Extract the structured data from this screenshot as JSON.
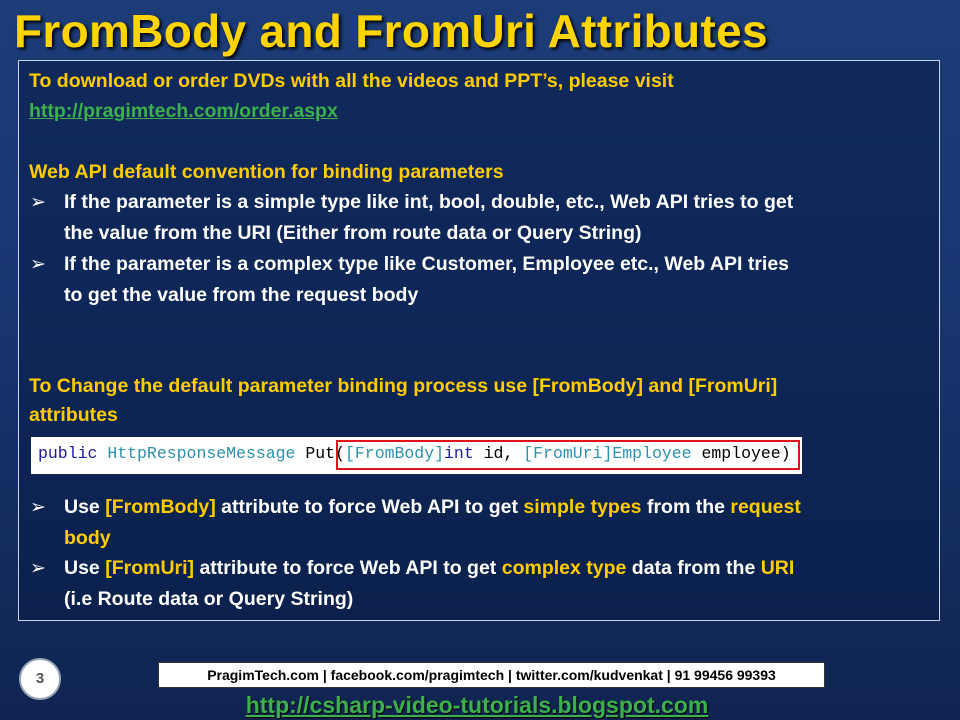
{
  "slide": {
    "title": "FromBody and FromUri Attributes",
    "page_number": "3"
  },
  "content": {
    "download_text": "To download or order DVDs with all the videos and PPT’s, please visit",
    "download_link": "http://pragimtech.com/order.aspx",
    "convention_heading": "Web API default convention for binding parameters",
    "bullets1": [
      {
        "line1": "If the parameter is a simple type like int, bool, double, etc., Web API tries to get",
        "line2": "the value from the URI (Either from route data or Query String)"
      },
      {
        "line1": "If the parameter is a complex type like Customer, Employee etc., Web API tries",
        "line2": "to get the value from the request body"
      }
    ],
    "change_heading_line1": "To Change the default parameter binding process use [FromBody] and [FromUri]",
    "change_heading_line2": "attributes",
    "code": {
      "kw_public": "public",
      "type_response": "HttpResponseMessage",
      "method": " Put",
      "open_paren": "(",
      "attr_body": "[FromBody]",
      "int_kw": "int",
      "param_id": " id, ",
      "attr_uri": "[FromUri]",
      "type_employee": "Employee",
      "param_employee": " employee)"
    },
    "bullets2": [
      {
        "p1": "Use ",
        "h1": "[FromBody]",
        "p2": " attribute to force Web API to get ",
        "h2": "simple types",
        "p3": " from the ",
        "h3": "request",
        "line2": "body"
      },
      {
        "p1": "Use ",
        "h1": "[FromUri]",
        "p2": " attribute to force Web API to get ",
        "h2": "complex type",
        "p3": " data from the ",
        "h3": "URI",
        "line2": "(i.e Route data or Query String)"
      }
    ]
  },
  "footer": {
    "info": "PragimTech.com | facebook.com/pragimtech | twitter.com/kudvenkat | 91 99456 99393",
    "url": "http://csharp-video-tutorials.blogspot.com"
  },
  "colors": {
    "title": "#ffd400",
    "heading": "#ffcc00",
    "link": "#3cb04a",
    "highlight_box": "#e0121a"
  },
  "icons": {
    "bullet": "arrow-bullet-icon"
  }
}
